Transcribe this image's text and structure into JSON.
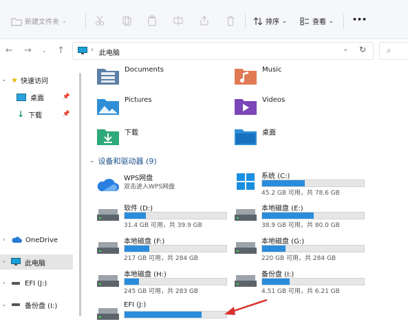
{
  "toolbar": {
    "new_folder": "新建文件夹",
    "sort": "排序",
    "view": "查看",
    "more": "•••"
  },
  "address": {
    "location": "此电脑",
    "search_icon": "⌕"
  },
  "sidebar": {
    "items": [
      {
        "label": "快速访问"
      },
      {
        "label": "桌面"
      },
      {
        "label": "下载"
      },
      {
        "label": "OneDrive"
      },
      {
        "label": "此电脑"
      },
      {
        "label": "EFI (J:)"
      },
      {
        "label": "备份盘 (I:)"
      }
    ]
  },
  "folders": [
    {
      "label": "Documents"
    },
    {
      "label": "Music"
    },
    {
      "label": "Pictures"
    },
    {
      "label": "Videos"
    },
    {
      "label": "下载"
    },
    {
      "label": "桌面"
    }
  ],
  "devices": {
    "header": "设备和驱动器 (9)",
    "wps": {
      "name": "WPS网盘",
      "sub": "双击进入WPS网盘"
    },
    "drives": [
      {
        "name": "系统 (C:)",
        "free": "45.2 GB 可用，共 78.6 GB",
        "used": 0.42
      },
      {
        "name": "软件 (D:)",
        "free": "31.4 GB 可用，共 39.9 GB",
        "used": 0.21
      },
      {
        "name": "本地磁盘 (E:)",
        "free": "38.9 GB 可用，共 80.0 GB",
        "used": 0.51
      },
      {
        "name": "本地磁盘 (F:)",
        "free": "217 GB 可用，共 284 GB",
        "used": 0.24
      },
      {
        "name": "本地磁盘 (G:)",
        "free": "220 GB 可用，共 284 GB",
        "used": 0.23
      },
      {
        "name": "本地磁盘 (H:)",
        "free": "245 GB 可用，共 283 GB",
        "used": 0.14
      },
      {
        "name": "备份盘 (I:)",
        "free": "4.51 GB 可用，共 6.21 GB",
        "used": 0.27
      },
      {
        "name": "EFI (J:)",
        "free": "",
        "used": 0.76
      }
    ]
  },
  "colors": {
    "accent": "#2a8cdc",
    "arrow": "#d9302e"
  }
}
